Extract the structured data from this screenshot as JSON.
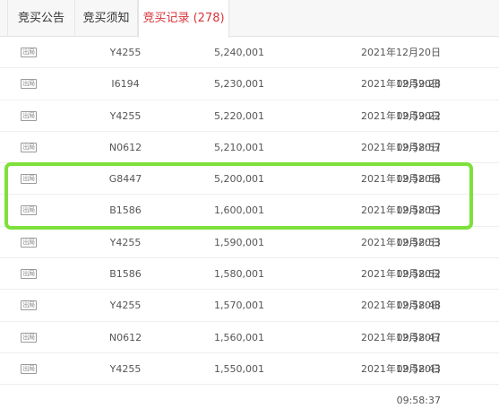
{
  "tabs": [
    {
      "label": "竞买公告"
    },
    {
      "label": "竞买须知"
    },
    {
      "label": "竞买记录 (278)"
    }
  ],
  "records": [
    {
      "status": "出局",
      "bidder": "Y4255",
      "price": "5,240,001",
      "time": "2021年12月20日 09:59:28"
    },
    {
      "status": "出局",
      "bidder": "I6194",
      "price": "5,230,001",
      "time": "2021年12月20日 09:59:22"
    },
    {
      "status": "出局",
      "bidder": "Y4255",
      "price": "5,220,001",
      "time": "2021年12月20日 09:58:57"
    },
    {
      "status": "出局",
      "bidder": "N0612",
      "price": "5,210,001",
      "time": "2021年12月20日 09:58:56"
    },
    {
      "status": "出局",
      "bidder": "G8447",
      "price": "5,200,001",
      "time": "2021年12月20日 09:58:53"
    },
    {
      "status": "出局",
      "bidder": "B1586",
      "price": "1,600,001",
      "time": "2021年12月20日 09:58:53"
    },
    {
      "status": "出局",
      "bidder": "Y4255",
      "price": "1,590,001",
      "time": "2021年12月20日 09:58:52"
    },
    {
      "status": "出局",
      "bidder": "B1586",
      "price": "1,580,001",
      "time": "2021年12月20日 09:58:48"
    },
    {
      "status": "出局",
      "bidder": "Y4255",
      "price": "1,570,001",
      "time": "2021年12月20日 09:58:47"
    },
    {
      "status": "出局",
      "bidder": "N0612",
      "price": "1,560,001",
      "time": "2021年12月20日 09:58:43"
    },
    {
      "status": "出局",
      "bidder": "Y4255",
      "price": "1,550,001",
      "time": "2021年12月20日 09:58:37"
    }
  ],
  "colors": {
    "active_tab": "#d9343a",
    "highlight": "#7ee03b"
  }
}
